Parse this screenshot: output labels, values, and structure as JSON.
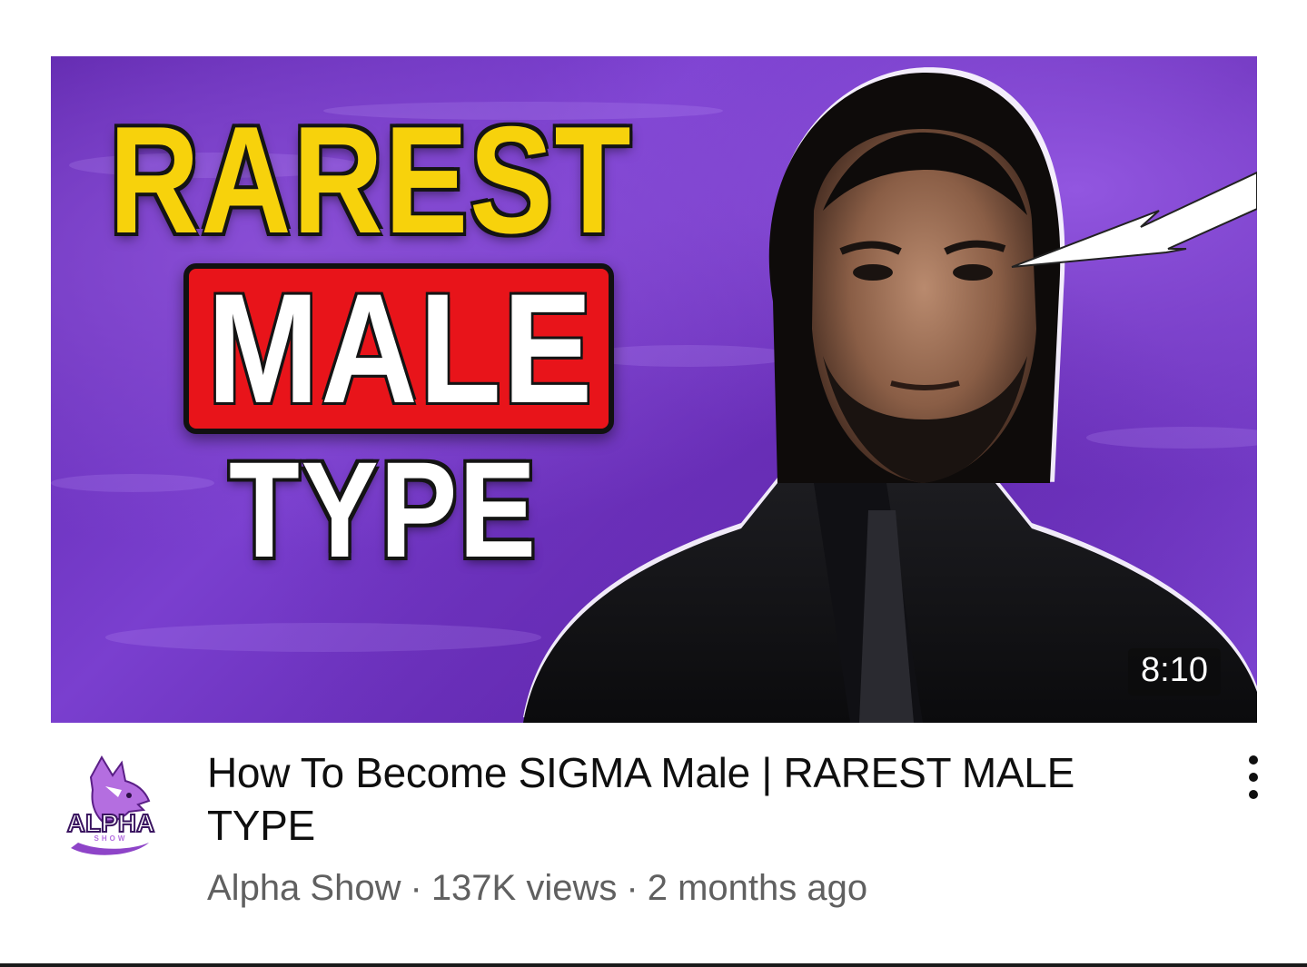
{
  "video": {
    "thumbnail": {
      "line1": "RAREST",
      "line2": "MALE",
      "line3": "TYPE",
      "duration": "8:10",
      "background_color": "#6b30bd",
      "line1_color": "#f7d20c",
      "box_color": "#e8141a"
    },
    "title": "How To Become SIGMA Male | RAREST MALE TYPE",
    "channel_name": "Alpha Show",
    "views": "137K views",
    "age": "2 months ago",
    "separator": "·",
    "avatar": {
      "icon": "wolf-logo-icon",
      "text_main": "ALPHA",
      "text_sub": "SHOW",
      "color": "#8e44c8"
    },
    "more_icon": "vertical-ellipsis-icon"
  }
}
